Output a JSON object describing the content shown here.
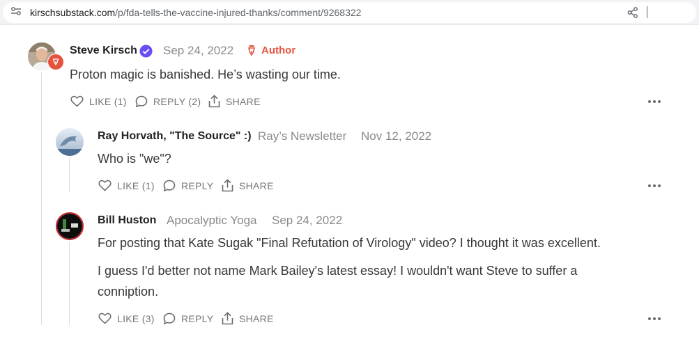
{
  "browser": {
    "url_host": "kirschsubstack.com",
    "url_path": "/p/fda-tells-the-vaccine-injured-thanks/comment/9268322"
  },
  "comments": [
    {
      "author": "Steve Kirsch",
      "date": "Sep 24, 2022",
      "badge": "Author",
      "text": "Proton magic is banished. He’s wasting our time.",
      "like": "LIKE (1)",
      "reply": "REPLY (2)",
      "share": "SHARE"
    },
    {
      "author": "Ray Horvath, \"The Source\" :)",
      "publication": "Ray’s Newsletter",
      "date": "Nov 12, 2022",
      "text": "Who is \"we\"?",
      "like": "LIKE (1)",
      "reply": "REPLY",
      "share": "SHARE"
    },
    {
      "author": "Bill Huston",
      "publication": "Apocalyptic Yoga",
      "date": "Sep 24, 2022",
      "text_p1": "For posting that Kate Sugak \"Final Refutation of Virology\" video? I thought it was excellent.",
      "text_p2": "I guess I'd better not name Mark Bailey's latest essay! I wouldn't want Steve to suffer a conniption.",
      "like": "LIKE (3)",
      "reply": "REPLY",
      "share": "SHARE"
    }
  ],
  "colors": {
    "accent_badge": "#e5533f",
    "verified": "#6b4cf5"
  }
}
